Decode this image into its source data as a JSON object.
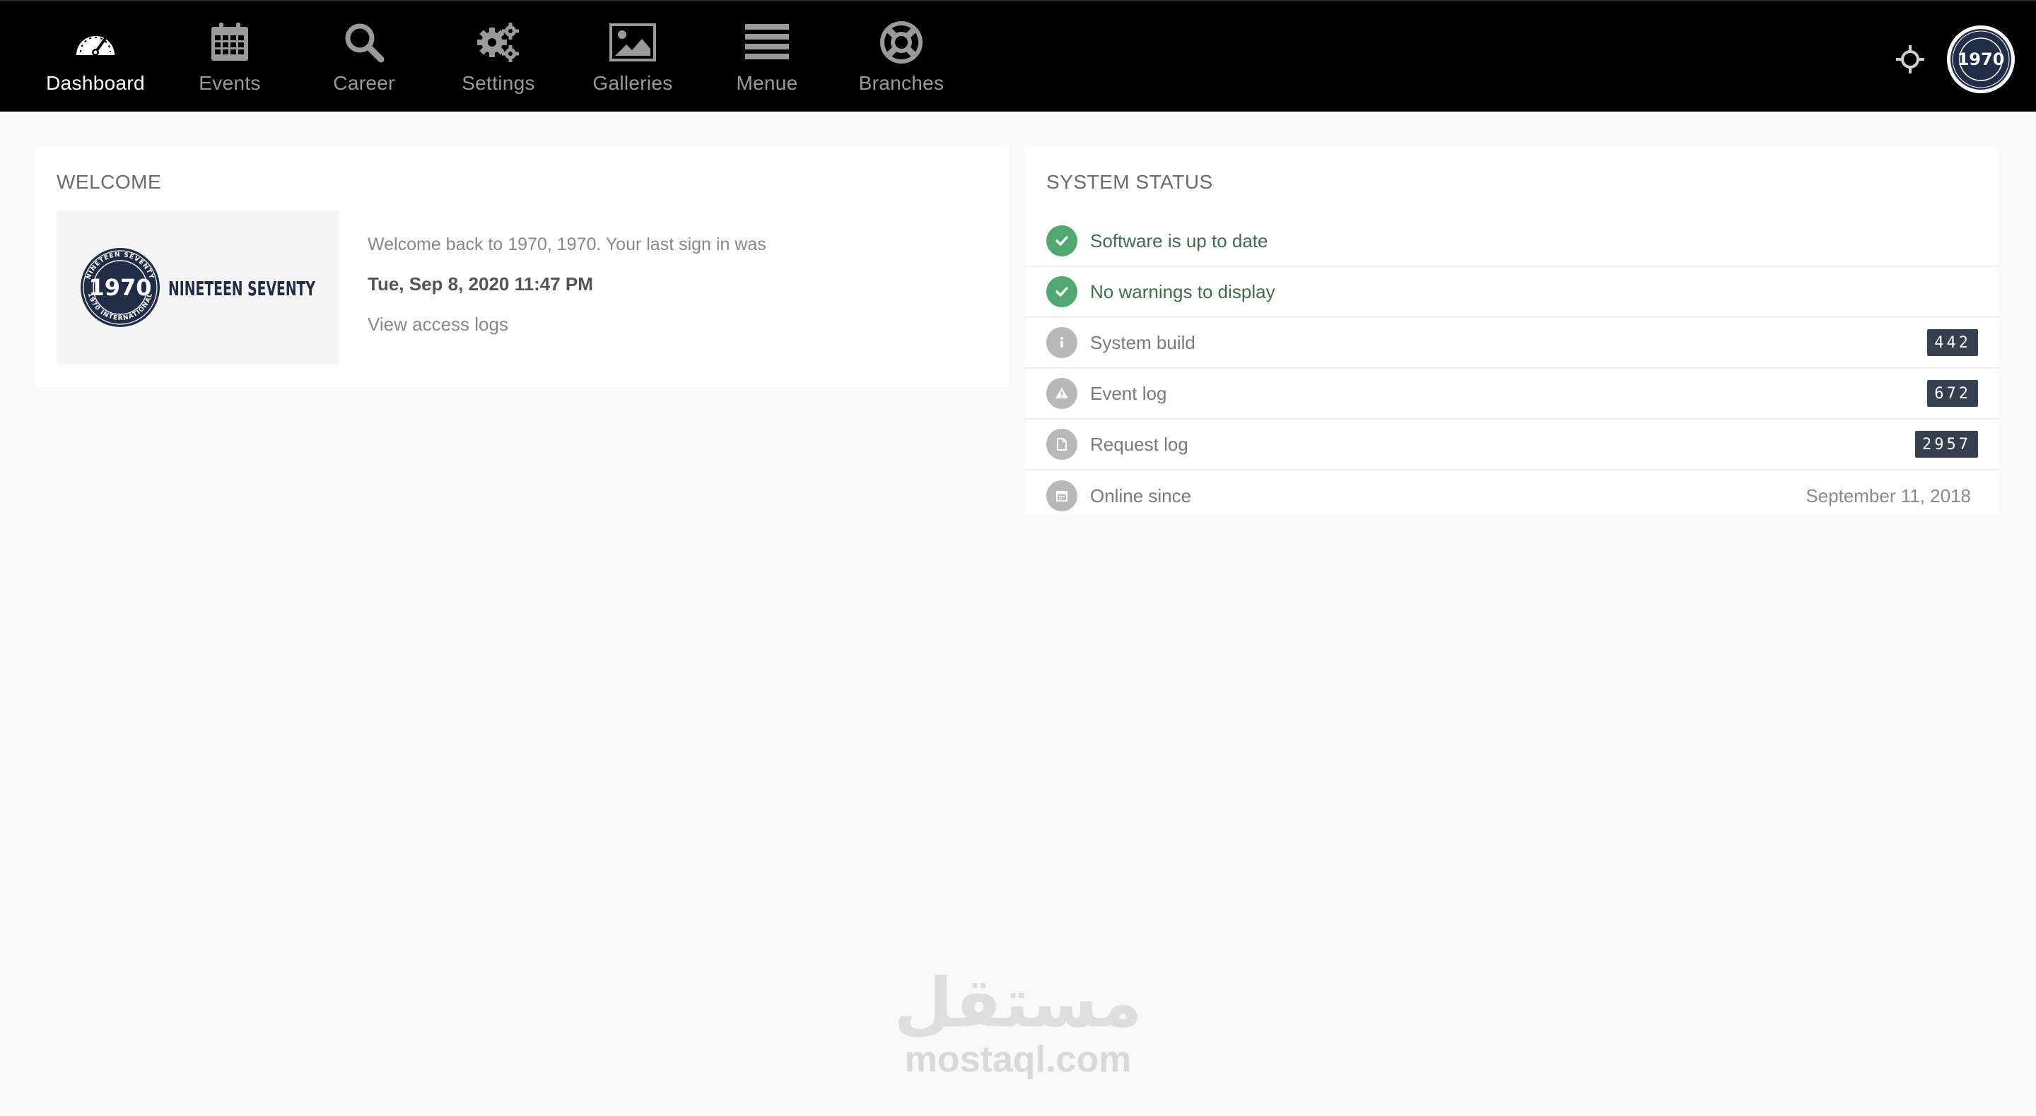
{
  "nav": {
    "items": [
      {
        "label": "Dashboard",
        "icon": "speedometer-icon"
      },
      {
        "label": "Events",
        "icon": "calendar-icon"
      },
      {
        "label": "Career",
        "icon": "search-icon"
      },
      {
        "label": "Settings",
        "icon": "gears-icon"
      },
      {
        "label": "Galleries",
        "icon": "image-icon"
      },
      {
        "label": "Menue",
        "icon": "menu-lines-icon"
      },
      {
        "label": "Branches",
        "icon": "lifebuoy-icon"
      }
    ],
    "active": "Dashboard"
  },
  "avatar": {
    "text": "1970"
  },
  "welcome": {
    "title": "WELCOME",
    "logo": {
      "number": "1970",
      "wordmark": "NINETEEN SEVENTY",
      "ring_top": "NINETEEN SEVENTY",
      "ring_bottom": "1970 INTERNATIONAL"
    },
    "message": "Welcome back to 1970, 1970. Your last sign in was",
    "last_sign_in": "Tue, Sep 8, 2020 11:47 PM",
    "access_logs_link": "View access logs"
  },
  "system_status": {
    "title": "SYSTEM STATUS",
    "rows": [
      {
        "label": "Software is up to date",
        "icon": "check-icon",
        "state": "ok"
      },
      {
        "label": "No warnings to display",
        "icon": "check-icon",
        "state": "ok"
      },
      {
        "label": "System build",
        "icon": "info-icon",
        "state": "neutral",
        "badge": "442"
      },
      {
        "label": "Event log",
        "icon": "warning-icon",
        "state": "neutral",
        "badge": "672"
      },
      {
        "label": "Request log",
        "icon": "document-icon",
        "state": "neutral",
        "badge": "2957"
      },
      {
        "label": "Online since",
        "icon": "calendar-small-icon",
        "state": "neutral",
        "value": "September 11, 2018"
      }
    ]
  },
  "watermark": {
    "arabic": "مستقل",
    "latin": "mostaql.com"
  },
  "colors": {
    "topbar": "#000000",
    "background": "#f9f9f9",
    "ok": "#4fa86d",
    "badge": "#34404f"
  }
}
